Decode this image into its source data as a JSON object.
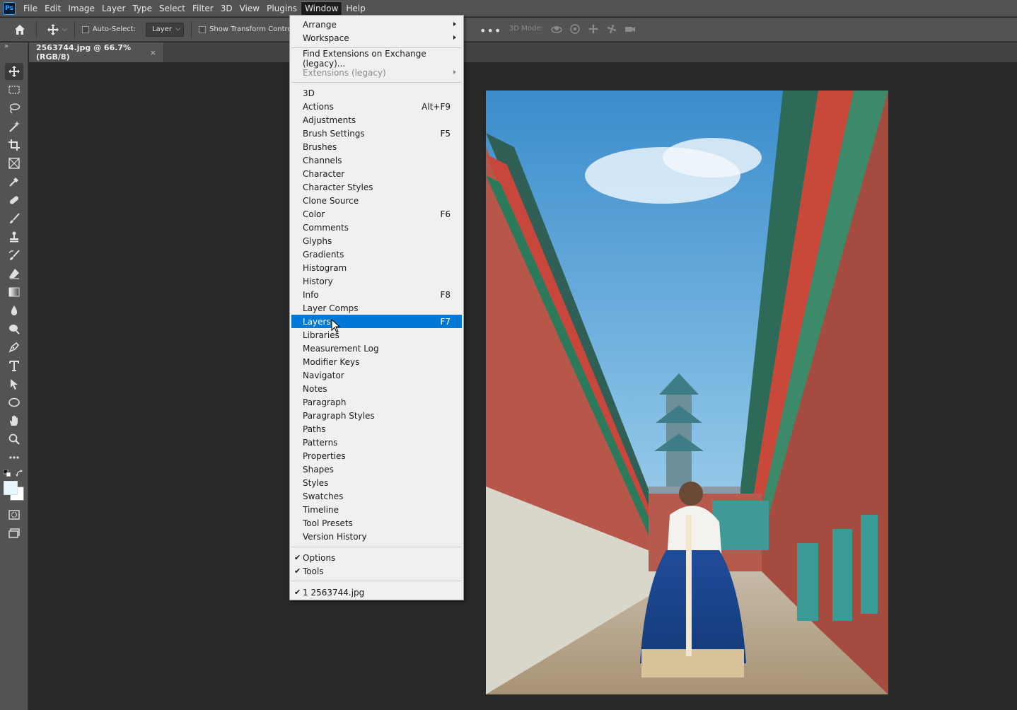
{
  "app": {
    "logo": "Ps",
    "menus": [
      "File",
      "Edit",
      "Image",
      "Layer",
      "Type",
      "Select",
      "Filter",
      "3D",
      "View",
      "Plugins",
      "Window",
      "Help"
    ],
    "active_menu": "Window"
  },
  "options_bar": {
    "auto_select_label": "Auto-Select:",
    "auto_select_checked": false,
    "auto_select_target": "Layer",
    "show_transform_label": "Show Transform Controls",
    "show_transform_checked": false,
    "more_label": "•••",
    "mode_3d_label": "3D Mode:",
    "icons_3d": [
      "orbit-3d-icon",
      "roll-3d-icon",
      "pan-3d-icon",
      "slide-3d-icon",
      "camera-3d-icon"
    ]
  },
  "toolbar": {
    "tools": [
      "move-tool",
      "rectangular-marquee-tool",
      "lasso-tool",
      "magic-wand-tool",
      "crop-tool",
      "frame-tool",
      "eyedropper-tool",
      "healing-brush-tool",
      "brush-tool",
      "clone-stamp-tool",
      "history-brush-tool",
      "eraser-tool",
      "gradient-tool",
      "blur-tool",
      "dodge-tool",
      "pen-tool",
      "type-tool",
      "path-selection-tool",
      "ellipse-tool",
      "hand-tool",
      "zoom-tool",
      "edit-toolbar",
      "default-colors",
      "swap-colors",
      "foreground-color",
      "quick-mask",
      "screen-mode"
    ],
    "foreground_color": "#e8f7ff",
    "background_color": "#ffffff"
  },
  "document": {
    "tab_title": "2563744.jpg @ 66.7% (RGB/8)",
    "close_glyph": "×"
  },
  "window_menu": {
    "group1": [
      {
        "label": "Arrange",
        "submenu": true
      },
      {
        "label": "Workspace",
        "submenu": true
      }
    ],
    "group2": [
      {
        "label": "Find Extensions on Exchange (legacy)...",
        "submenu": false
      },
      {
        "label": "Extensions (legacy)",
        "submenu": true,
        "disabled": true
      }
    ],
    "panels": [
      {
        "label": "3D",
        "shortcut": ""
      },
      {
        "label": "Actions",
        "shortcut": "Alt+F9"
      },
      {
        "label": "Adjustments",
        "shortcut": ""
      },
      {
        "label": "Brush Settings",
        "shortcut": "F5"
      },
      {
        "label": "Brushes",
        "shortcut": ""
      },
      {
        "label": "Channels",
        "shortcut": ""
      },
      {
        "label": "Character",
        "shortcut": ""
      },
      {
        "label": "Character Styles",
        "shortcut": ""
      },
      {
        "label": "Clone Source",
        "shortcut": ""
      },
      {
        "label": "Color",
        "shortcut": "F6"
      },
      {
        "label": "Comments",
        "shortcut": ""
      },
      {
        "label": "Glyphs",
        "shortcut": ""
      },
      {
        "label": "Gradients",
        "shortcut": ""
      },
      {
        "label": "Histogram",
        "shortcut": ""
      },
      {
        "label": "History",
        "shortcut": ""
      },
      {
        "label": "Info",
        "shortcut": "F8"
      },
      {
        "label": "Layer Comps",
        "shortcut": ""
      },
      {
        "label": "Layers",
        "shortcut": "F7",
        "highlighted": true
      },
      {
        "label": "Libraries",
        "shortcut": ""
      },
      {
        "label": "Measurement Log",
        "shortcut": ""
      },
      {
        "label": "Modifier Keys",
        "shortcut": ""
      },
      {
        "label": "Navigator",
        "shortcut": ""
      },
      {
        "label": "Notes",
        "shortcut": ""
      },
      {
        "label": "Paragraph",
        "shortcut": ""
      },
      {
        "label": "Paragraph Styles",
        "shortcut": ""
      },
      {
        "label": "Paths",
        "shortcut": ""
      },
      {
        "label": "Patterns",
        "shortcut": ""
      },
      {
        "label": "Properties",
        "shortcut": ""
      },
      {
        "label": "Shapes",
        "shortcut": ""
      },
      {
        "label": "Styles",
        "shortcut": ""
      },
      {
        "label": "Swatches",
        "shortcut": ""
      },
      {
        "label": "Timeline",
        "shortcut": ""
      },
      {
        "label": "Tool Presets",
        "shortcut": ""
      },
      {
        "label": "Version History",
        "shortcut": ""
      }
    ],
    "toggles": [
      {
        "label": "Options",
        "checked": true
      },
      {
        "label": "Tools",
        "checked": true
      }
    ],
    "documents": [
      {
        "label": "1 2563744.jpg",
        "checked": true
      }
    ],
    "check_glyph": "✔"
  },
  "colors": {
    "highlight": "#0078d7",
    "menu_bg": "#f0f0f0",
    "chrome": "#535353",
    "canvas_bg": "#282828"
  }
}
